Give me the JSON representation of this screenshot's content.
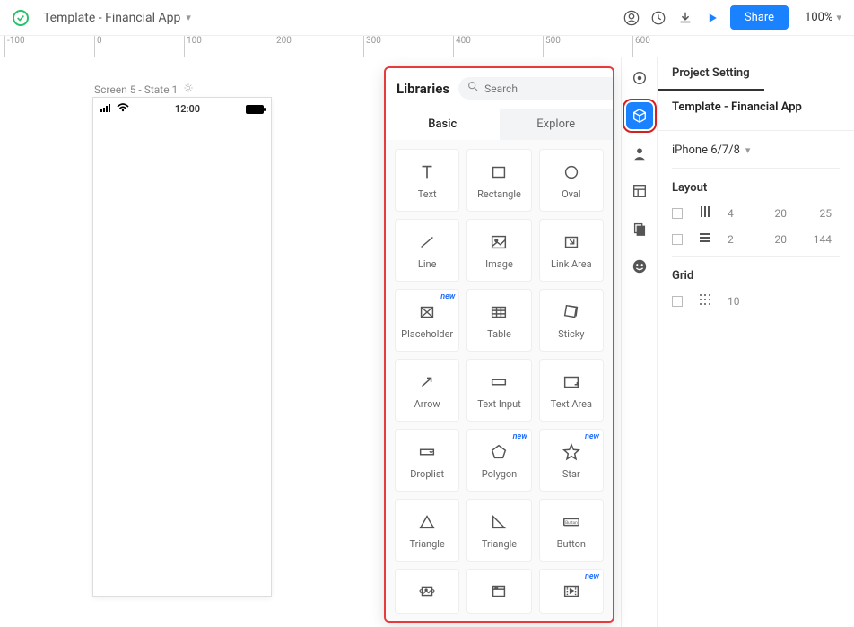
{
  "topbar": {
    "project_title": "Template - Financial App",
    "share_label": "Share",
    "zoom": "100%"
  },
  "ruler": {
    "marks": [
      -100,
      0,
      100,
      200,
      300,
      400,
      500,
      600
    ]
  },
  "canvas": {
    "screen_label": "Screen 5 - State 1",
    "statusbar": {
      "signal_icon": "signal",
      "wifi_icon": "wifi",
      "time": "12:00",
      "battery_icon": "battery-full"
    }
  },
  "tool_column": {
    "items": [
      {
        "name": "target-icon",
        "active": false
      },
      {
        "name": "cube-icon",
        "active": true,
        "outlined": true
      },
      {
        "name": "person-icon",
        "active": false
      },
      {
        "name": "layout-icon",
        "active": false
      },
      {
        "name": "layers-icon",
        "active": false
      },
      {
        "name": "smile-icon",
        "active": false
      }
    ]
  },
  "right_panel": {
    "tab_label": "Project Setting",
    "project_name": "Template - Financial App",
    "device": "iPhone 6/7/8",
    "layout_label": "Layout",
    "layout_rows": [
      {
        "icon": "columns",
        "a": "4",
        "b": "20",
        "c": "25"
      },
      {
        "icon": "rows",
        "a": "2",
        "b": "20",
        "c": "144"
      }
    ],
    "grid_label": "Grid",
    "grid_row": {
      "icon": "grid",
      "a": "10"
    }
  },
  "libraries": {
    "title": "Libraries",
    "search_placeholder": "Search",
    "tabs": {
      "basic": "Basic",
      "explore": "Explore"
    },
    "items": [
      {
        "label": "Text",
        "icon": "text",
        "new": false
      },
      {
        "label": "Rectangle",
        "icon": "rectangle",
        "new": false
      },
      {
        "label": "Oval",
        "icon": "oval",
        "new": false
      },
      {
        "label": "Line",
        "icon": "line",
        "new": false
      },
      {
        "label": "Image",
        "icon": "image",
        "new": false
      },
      {
        "label": "Link Area",
        "icon": "link-area",
        "new": false
      },
      {
        "label": "Placeholder",
        "icon": "placeholder",
        "new": true
      },
      {
        "label": "Table",
        "icon": "table",
        "new": false
      },
      {
        "label": "Sticky",
        "icon": "sticky",
        "new": false
      },
      {
        "label": "Arrow",
        "icon": "arrow",
        "new": false
      },
      {
        "label": "Text Input",
        "icon": "text-input",
        "new": false
      },
      {
        "label": "Text Area",
        "icon": "text-area",
        "new": false
      },
      {
        "label": "Droplist",
        "icon": "droplist",
        "new": false
      },
      {
        "label": "Polygon",
        "icon": "polygon",
        "new": true
      },
      {
        "label": "Star",
        "icon": "star",
        "new": true
      },
      {
        "label": "Triangle",
        "icon": "triangle",
        "new": false
      },
      {
        "label": "Triangle",
        "icon": "triangle-right",
        "new": false
      },
      {
        "label": "Button",
        "icon": "button",
        "new": false
      },
      {
        "label": "",
        "icon": "carousel",
        "new": false,
        "partial": true
      },
      {
        "label": "",
        "icon": "window",
        "new": false,
        "partial": true
      },
      {
        "label": "",
        "icon": "video",
        "new": true,
        "partial": true
      }
    ]
  }
}
